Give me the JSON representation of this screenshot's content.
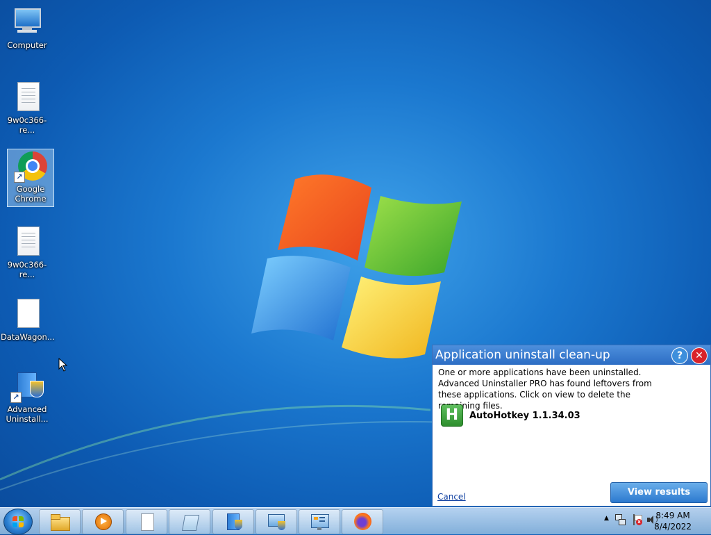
{
  "desktop": {
    "icons": [
      {
        "label": "Computer",
        "icon": "computer-icon"
      },
      {
        "label": "9w0c366-re...",
        "icon": "text-file-icon"
      },
      {
        "label": "Google Chrome",
        "icon": "chrome-icon"
      },
      {
        "label": "9w0c366-re...",
        "icon": "text-file-icon"
      },
      {
        "label": "DataWagon...",
        "icon": "blank-file-icon"
      },
      {
        "label": "Advanced Uninstall...",
        "icon": "advanced-uninstaller-icon"
      }
    ]
  },
  "dialog": {
    "title": "Application uninstall clean-up",
    "help_glyph": "?",
    "close_glyph": "✕",
    "message": "One or more applications have been uninstalled. Advanced Uninstaller PRO has found leftovers from these applications. Click on view to delete the remaining files.",
    "app_icon_letter": "H",
    "app_name": "AutoHotkey 1.1.34.03",
    "cancel_label": "Cancel",
    "view_button_label": "View results"
  },
  "taskbar": {
    "start_icon": "windows-start-orb-icon",
    "pinned": [
      "file-explorer-icon",
      "media-player-icon",
      "blank-document-icon",
      "notepad-icon",
      "advanced-uninstaller-icon",
      "network-monitor-icon",
      "settings-panel-icon",
      "firefox-icon"
    ],
    "tray": {
      "show_hidden_glyph": "▲",
      "icons": [
        "network-icon",
        "action-center-flag-icon",
        "volume-icon"
      ],
      "time": "8:49 AM",
      "date": "8/4/2022"
    }
  },
  "colors": {
    "dialog_title_bar": "#2c6dc4",
    "view_button": "#2c79cf",
    "close_button": "#d9232a",
    "app_icon_green": "#2e8f2e"
  }
}
